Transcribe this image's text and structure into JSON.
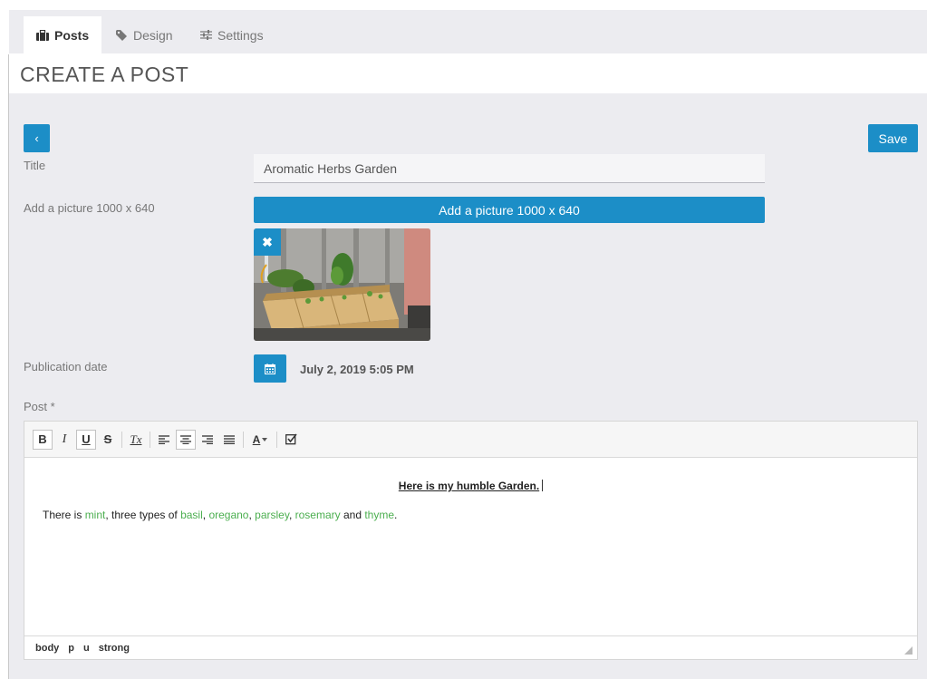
{
  "tabs": [
    {
      "label": "Posts",
      "icon": "briefcase-icon",
      "active": true
    },
    {
      "label": "Design",
      "icon": "tag-icon",
      "active": false
    },
    {
      "label": "Settings",
      "icon": "sliders-icon",
      "active": false
    }
  ],
  "page": {
    "title": "CREATE A POST"
  },
  "form": {
    "back_label": "‹",
    "save_label": "Save",
    "title_label": "Title",
    "title_value": "Aromatic Herbs Garden",
    "picture_label": "Add a picture 1000 x 640",
    "picture_button": "Add a picture 1000 x 640",
    "remove_picture": "✖",
    "date_label": "Publication date",
    "date_value": "July 2, 2019 5:05 PM",
    "post_label": "Post *"
  },
  "editor": {
    "toolbar": {
      "bold": "B",
      "italic": "I",
      "underline": "U",
      "strike": "S",
      "clear_format": "Tx",
      "text_color": "A"
    },
    "heading": "Here is my humble Garden.",
    "para": {
      "t1": "There is ",
      "h1": "mint",
      "t2": ", three types of ",
      "h2": "basil",
      "t3": ", ",
      "h3": "oregano",
      "t4": ", ",
      "h4": "parsley",
      "t5": ", ",
      "h5": "rosemary",
      "t6": " and ",
      "h6": "thyme",
      "t7": "."
    },
    "path": [
      "body",
      "p",
      "u",
      "strong"
    ]
  },
  "colors": {
    "accent": "#1c8ec7",
    "herb_link": "#4caf50",
    "background": "#ececf0"
  }
}
